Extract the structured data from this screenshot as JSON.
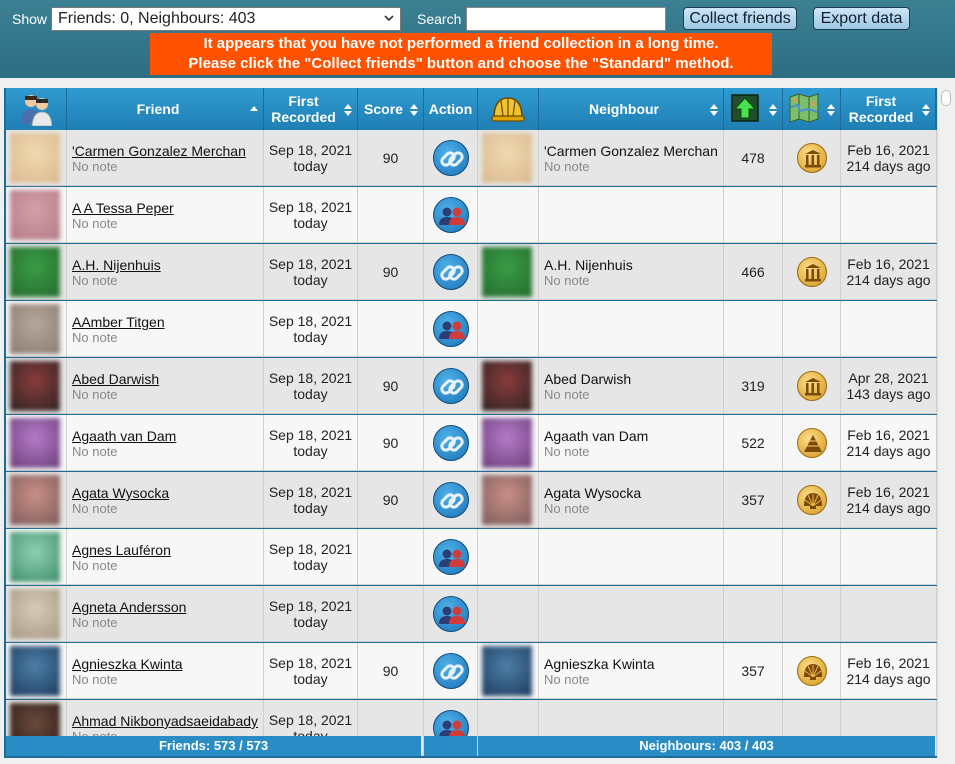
{
  "toolbar": {
    "show_label": "Show",
    "show_value": "Friends: 0, Neighbours: 403",
    "search_label": "Search",
    "search_value": "",
    "collect_label": "Collect friends",
    "export_label": "Export data"
  },
  "alert": {
    "line1": "It appears that you have not performed a friend collection in a long time.",
    "line2": "Please click the \"Collect friends\" button and choose the \"Standard\" method."
  },
  "columns": {
    "friend": "Friend",
    "first_recorded_1": "First",
    "first_recorded_2": "Recorded",
    "score": "Score",
    "action": "Action",
    "neighbour": "Neighbour",
    "nb_first_recorded_1": "First",
    "nb_first_recorded_2": "Recorded"
  },
  "rows": [
    {
      "friend": "'Carmen Gonzalez Merchan",
      "note": "No note",
      "date": "Sep 18, 2021",
      "ago": "today",
      "score": "90",
      "action": "link",
      "avatar": [
        "#f1d9b0",
        "#d9b88f"
      ],
      "neighbour": {
        "name": "'Carmen Gonzalez Merchan",
        "note": "No note",
        "level": "478",
        "era": "columns",
        "date": "Feb 16, 2021",
        "ago": "214 days ago"
      }
    },
    {
      "friend": "A A Tessa Peper",
      "note": "No note",
      "date": "Sep 18, 2021",
      "ago": "today",
      "score": "",
      "action": "people",
      "avatar": [
        "#d7a0a8",
        "#b17a85"
      ],
      "neighbour": null
    },
    {
      "friend": "A.H. Nijenhuis",
      "note": "No note",
      "date": "Sep 18, 2021",
      "ago": "today",
      "score": "90",
      "action": "link",
      "avatar": [
        "#3a9d46",
        "#246b2e"
      ],
      "neighbour": {
        "name": "A.H. Nijenhuis",
        "note": "No note",
        "level": "466",
        "era": "columns",
        "date": "Feb 16, 2021",
        "ago": "214 days ago"
      }
    },
    {
      "friend": "AAmber Titgen",
      "note": "No note",
      "date": "Sep 18, 2021",
      "ago": "today",
      "score": "",
      "action": "people",
      "avatar": [
        "#b7a79b",
        "#8a7b70"
      ],
      "neighbour": null
    },
    {
      "friend": "Abed Darwish",
      "note": "No note",
      "date": "Sep 18, 2021",
      "ago": "today",
      "score": "90",
      "action": "link",
      "avatar": [
        "#8a3c3c",
        "#2e2222"
      ],
      "neighbour": {
        "name": "Abed Darwish",
        "note": "No note",
        "level": "319",
        "era": "columns",
        "date": "Apr 28, 2021",
        "ago": "143 days ago"
      }
    },
    {
      "friend": "Agaath van Dam",
      "note": "No note",
      "date": "Sep 18, 2021",
      "ago": "today",
      "score": "90",
      "action": "link",
      "avatar": [
        "#b67ac9",
        "#6a3f7a"
      ],
      "neighbour": {
        "name": "Agaath van Dam",
        "note": "No note",
        "level": "522",
        "era": "pyramid",
        "date": "Feb 16, 2021",
        "ago": "214 days ago"
      }
    },
    {
      "friend": "Agata Wysocka",
      "note": "No note",
      "date": "Sep 18, 2021",
      "ago": "today",
      "score": "90",
      "action": "link",
      "avatar": [
        "#c98f86",
        "#7b5b5a"
      ],
      "neighbour": {
        "name": "Agata Wysocka",
        "note": "No note",
        "level": "357",
        "era": "shell",
        "date": "Feb 16, 2021",
        "ago": "214 days ago"
      }
    },
    {
      "friend": "Agnes Lauféron",
      "note": "No note",
      "date": "Sep 18, 2021",
      "ago": "today",
      "score": "",
      "action": "people",
      "avatar": [
        "#8fcfb3",
        "#3f8f6a"
      ],
      "neighbour": null
    },
    {
      "friend": "Agneta Andersson",
      "note": "No note",
      "date": "Sep 18, 2021",
      "ago": "today",
      "score": "",
      "action": "people",
      "avatar": [
        "#d8cbb7",
        "#a69882"
      ],
      "neighbour": null
    },
    {
      "friend": "Agnieszka Kwinta",
      "note": "No note",
      "date": "Sep 18, 2021",
      "ago": "today",
      "score": "90",
      "action": "link",
      "avatar": [
        "#4d7fa8",
        "#1e3c5e"
      ],
      "neighbour": {
        "name": "Agnieszka Kwinta",
        "note": "No note",
        "level": "357",
        "era": "shell",
        "date": "Feb 16, 2021",
        "ago": "214 days ago"
      }
    },
    {
      "friend": "Ahmad Nikbonyadsaeidabady",
      "note": "No note",
      "date": "Sep 18, 2021",
      "ago": "today",
      "score": "",
      "action": "people",
      "avatar": [
        "#6b4b3d",
        "#2a1c16"
      ],
      "neighbour": null
    }
  ],
  "footer": {
    "friends": "Friends: 573 / 573",
    "neighbours": "Neighbours: 403 / 403"
  },
  "colors": {
    "header_bg": "#2f9bd0",
    "alert_bg": "#ff5200",
    "row_alt": "#e6e6e6",
    "row": "#f7f7f7"
  }
}
